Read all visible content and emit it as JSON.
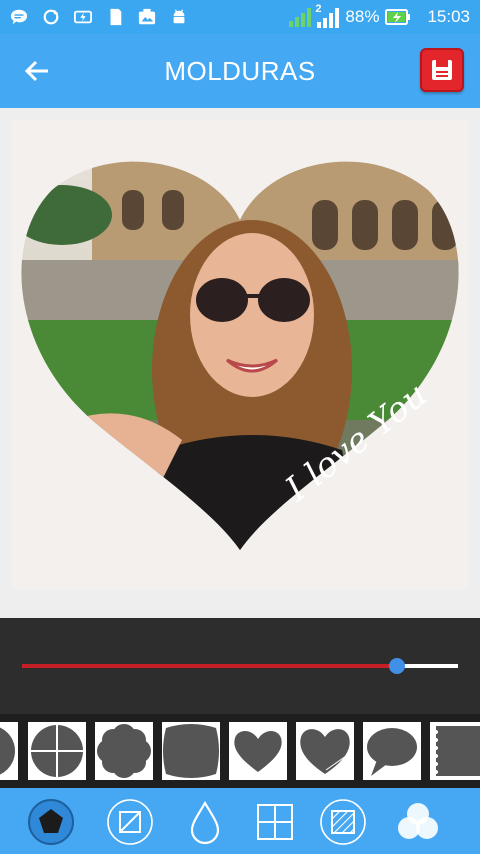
{
  "status_bar": {
    "battery_percent": "88%",
    "time": "15:03",
    "notification_icons": [
      "chat-icon",
      "sync-icon",
      "flash-icon",
      "sd-card-icon",
      "image-icon",
      "android-icon"
    ],
    "network_badge": "2"
  },
  "app_bar": {
    "title": "MOLDURAS",
    "back_icon": "arrow-left-icon",
    "save_icon": "save-icon"
  },
  "photo": {
    "overlay_text": "I love You"
  },
  "slider": {
    "value": 0.86,
    "fill_color": "#c62026",
    "thumb_color": "#3f90e6"
  },
  "frames": [
    {
      "name": "frame-circle-partial",
      "shape": "circle"
    },
    {
      "name": "frame-circle-cross",
      "shape": "circle-cross"
    },
    {
      "name": "frame-flower",
      "shape": "flower"
    },
    {
      "name": "frame-rounded-square",
      "shape": "rounded-square"
    },
    {
      "name": "frame-heart",
      "shape": "heart"
    },
    {
      "name": "frame-heart-text",
      "shape": "heart-text"
    },
    {
      "name": "frame-speech-bubble",
      "shape": "speech-bubble"
    },
    {
      "name": "frame-stamp",
      "shape": "stamp"
    }
  ],
  "toolbar": {
    "items": [
      "frame-tool-icon",
      "crop-tool-icon",
      "drop-tool-icon",
      "grid-tool-icon",
      "texture-tool-icon",
      "blend-tool-icon"
    ]
  },
  "colors": {
    "accent": "#45a8f2",
    "save_button": "#e3262c"
  }
}
